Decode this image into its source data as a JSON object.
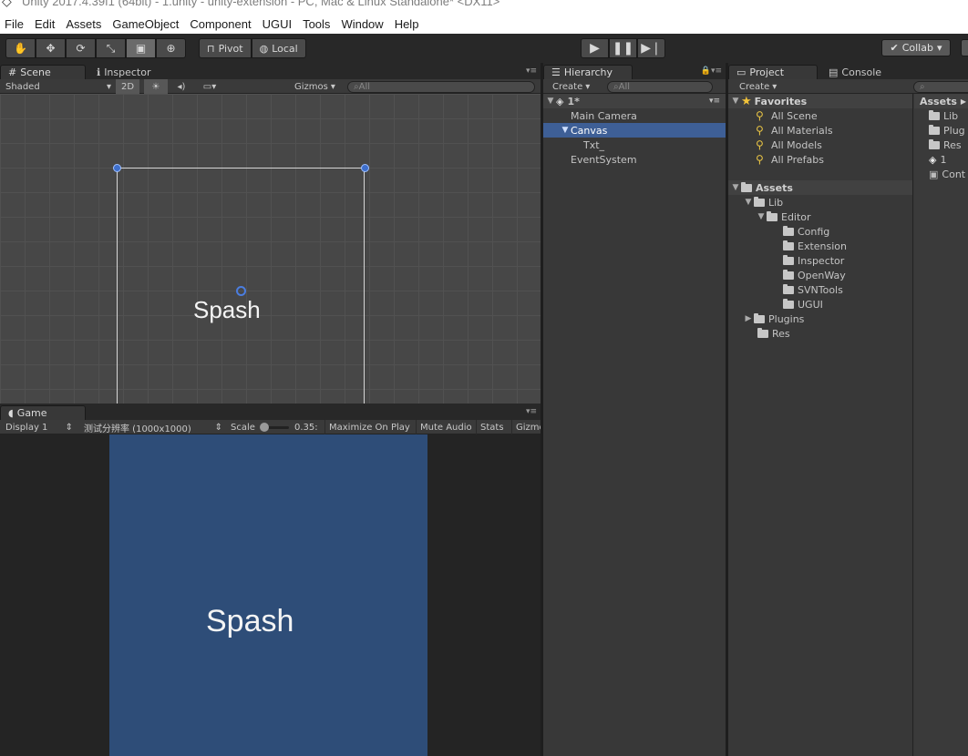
{
  "titlebar": {
    "text": "Unity 2017.4.39f1 (64bit) - 1.unity - unity-extension - PC, Mac & Linux Standalone* <DX11>"
  },
  "menu": [
    "File",
    "Edit",
    "Assets",
    "GameObject",
    "Component",
    "UGUI",
    "Tools",
    "Window",
    "Help"
  ],
  "toolbar": {
    "tools": [
      "hand-icon",
      "move-icon",
      "rotate-icon",
      "scale-icon",
      "rect-icon",
      "transform-icon"
    ],
    "pivot_label": "Pivot",
    "local_label": "Local",
    "collab_label": "Collab"
  },
  "scene_panel": {
    "tab_scene": "Scene",
    "tab_inspector": "Inspector",
    "shading": "Shaded",
    "mode_2d": "2D",
    "gizmos": "Gizmos",
    "search_placeholder": "All",
    "element_text": "Spash"
  },
  "game_panel": {
    "tab": "Game",
    "display": "Display 1",
    "resolution": "测试分辨率 (1000x1000)",
    "scale_label": "Scale",
    "scale_value": "0.35:",
    "maximize": "Maximize On Play",
    "mute": "Mute Audio",
    "stats": "Stats",
    "gizmos": "Gizmo",
    "element_text": "Spash"
  },
  "hierarchy": {
    "tab": "Hierarchy",
    "create": "Create",
    "search_placeholder": "All",
    "scene_name": "1*",
    "items": [
      {
        "label": "Main Camera",
        "depth": 1,
        "selected": false,
        "expandable": false
      },
      {
        "label": "Canvas",
        "depth": 1,
        "selected": true,
        "expandable": true
      },
      {
        "label": "Txt_",
        "depth": 2,
        "selected": false,
        "expandable": false
      },
      {
        "label": "EventSystem",
        "depth": 1,
        "selected": false,
        "expandable": false
      }
    ]
  },
  "project": {
    "tab_project": "Project",
    "tab_console": "Console",
    "create": "Create",
    "favorites_title": "Favorites",
    "favorites": [
      "All Scene",
      "All Materials",
      "All Models",
      "All Prefabs"
    ],
    "assets_title": "Assets",
    "tree": [
      {
        "label": "Lib",
        "depth": 1,
        "arrow": "open"
      },
      {
        "label": "Editor",
        "depth": 2,
        "arrow": "open"
      },
      {
        "label": "Config",
        "depth": 3,
        "arrow": "none"
      },
      {
        "label": "Extension",
        "depth": 3,
        "arrow": "none"
      },
      {
        "label": "Inspector",
        "depth": 3,
        "arrow": "none"
      },
      {
        "label": "OpenWay",
        "depth": 3,
        "arrow": "none"
      },
      {
        "label": "SVNTools",
        "depth": 3,
        "arrow": "none"
      },
      {
        "label": "UGUI",
        "depth": 3,
        "arrow": "none"
      },
      {
        "label": "Plugins",
        "depth": 1,
        "arrow": "closed"
      },
      {
        "label": "Res",
        "depth": 1,
        "arrow": "none"
      }
    ],
    "right_header": "Assets",
    "right_items": [
      {
        "label": "Lib",
        "icon": "folder-icon"
      },
      {
        "label": "Plug",
        "icon": "folder-icon"
      },
      {
        "label": "Res",
        "icon": "folder-icon"
      },
      {
        "label": "1",
        "icon": "unity-scene-icon"
      },
      {
        "label": "Cont",
        "icon": "script-icon"
      }
    ]
  }
}
